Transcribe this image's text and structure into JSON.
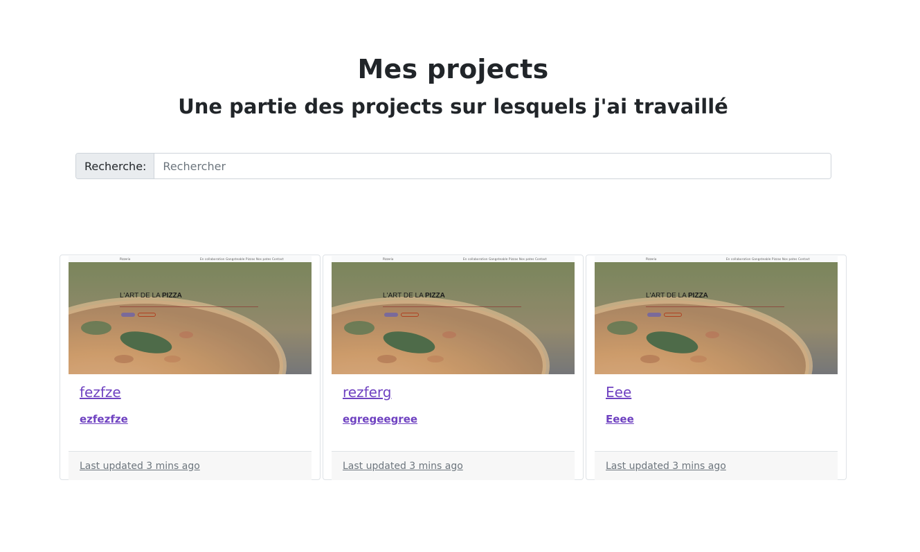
{
  "header": {
    "title": "Mes projects",
    "subtitle": "Une partie des projects sur lesquels j'ai travaillé"
  },
  "search": {
    "label": "Recherche:",
    "placeholder": "Rechercher",
    "value": ""
  },
  "projects": [
    {
      "title": "fezfze",
      "description": "ezfezfze",
      "updated": "Last updated 3 mins ago",
      "thumbnail": {
        "brand": "Pizzeria",
        "nav": "En collaboration   Gangsteable   Pizzas   Nos pates   Contact",
        "heading_light": "L'ART DE LA ",
        "heading_bold": "PIZZA"
      }
    },
    {
      "title": "rezferg",
      "description": "egregeegree",
      "updated": "Last updated 3 mins ago",
      "thumbnail": {
        "brand": "Pizzeria",
        "nav": "En collaboration   Gangsteable   Pizzas   Nos pates   Contact",
        "heading_light": "L'ART DE LA ",
        "heading_bold": "PIZZA"
      }
    },
    {
      "title": "Eee",
      "description": "Eeee",
      "updated": "Last updated 3 mins ago",
      "thumbnail": {
        "brand": "Pizzeria",
        "nav": "En collaboration   Gangsteable   Pizzas   Nos pates   Contact",
        "heading_light": "L'ART DE LA ",
        "heading_bold": "PIZZA"
      }
    }
  ],
  "colors": {
    "link": "#6f42c1",
    "muted": "#6c757d",
    "border": "#dee2e6",
    "footer_bg": "#f7f7f7",
    "search_label_bg": "#e9ecef"
  }
}
